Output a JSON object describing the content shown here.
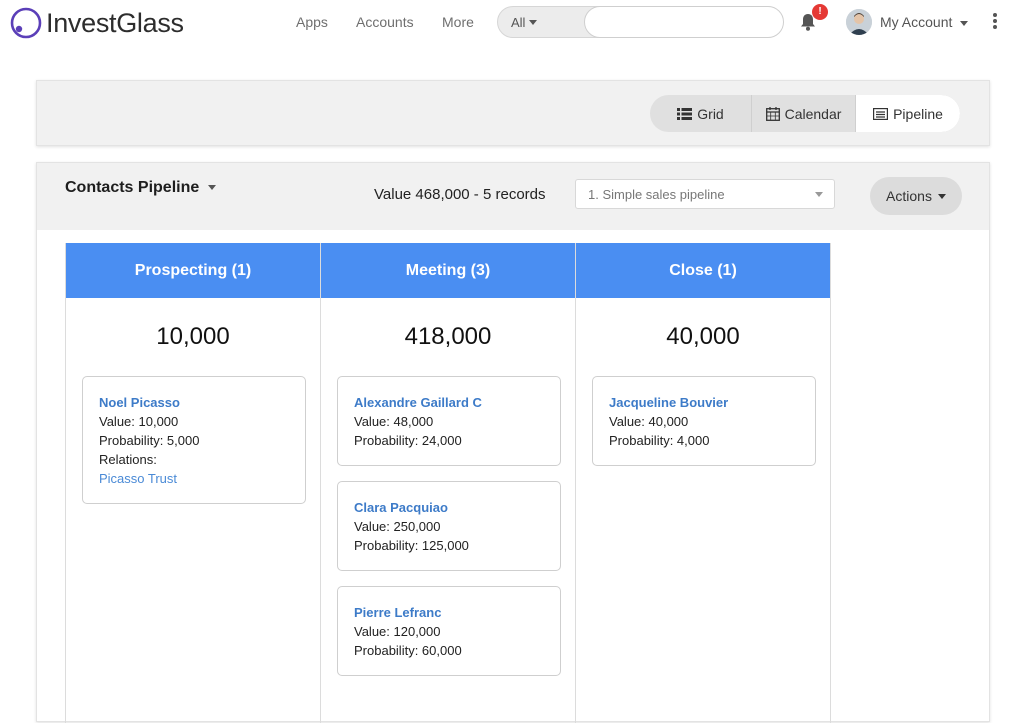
{
  "app": {
    "brand": "InvestGlass"
  },
  "nav": {
    "links": [
      "Apps",
      "Accounts",
      "More"
    ]
  },
  "search": {
    "scope": "All",
    "placeholder": "",
    "value": ""
  },
  "notifications": {
    "badge": "!"
  },
  "account": {
    "label": "My Account"
  },
  "views": {
    "grid": "Grid",
    "calendar": "Calendar",
    "pipeline": "Pipeline",
    "active": "Pipeline"
  },
  "pipeline": {
    "title": "Contacts Pipeline",
    "summary": "Value 468,000 - 5 records",
    "selected": "1. Simple sales pipeline",
    "actions_label": "Actions",
    "columns": [
      {
        "header": "Prospecting (1)",
        "total": "10,000",
        "cards": [
          {
            "name": "Noel Picasso",
            "value": "Value: 10,000",
            "probability": "Probability: 5,000",
            "relations_label": "Relations:",
            "relation": "Picasso Trust"
          }
        ]
      },
      {
        "header": "Meeting (3)",
        "total": "418,000",
        "cards": [
          {
            "name": "Alexandre Gaillard C",
            "value": "Value: 48,000",
            "probability": "Probability: 24,000"
          },
          {
            "name": "Clara Pacquiao",
            "value": "Value: 250,000",
            "probability": "Probability: 125,000"
          },
          {
            "name": "Pierre Lefranc",
            "value": "Value: 120,000",
            "probability": "Probability: 60,000"
          }
        ]
      },
      {
        "header": "Close (1)",
        "total": "40,000",
        "cards": [
          {
            "name": "Jacqueline Bouvier",
            "value": "Value: 40,000",
            "probability": "Probability: 4,000"
          }
        ]
      }
    ]
  },
  "colors": {
    "accent": "#4a8ef2",
    "link": "#3d7bc8",
    "badge": "#e53935"
  }
}
